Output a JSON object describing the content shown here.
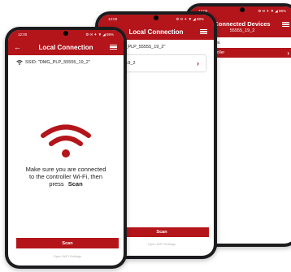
{
  "status_bar": {
    "time": "12:00",
    "indicators": "⚙ ✉ ✦ ▼ ◢ 98%"
  },
  "brand_color": "#b3151b",
  "phone_back": {
    "title": "Connected Devices",
    "subtitle": "55555_19_2",
    "section_label": "Room Devices",
    "device": "agora 4.0 Controller",
    "device_chevron": "›"
  },
  "phone_middle": {
    "title": "Local Connection",
    "ssid_line": "ID: \"DMG_PLP_55555_19_2\"",
    "network": "5555_19_2",
    "network_chevron": "›",
    "scan_label": "Scan",
    "link_label": "Open WiFi Settings"
  },
  "phone_front": {
    "title": "Local Connection",
    "back_icon": "←",
    "ssid_line": "SSID: \"DMG_PLP_55555_19_2\"",
    "message_line1": "Make sure you are connected",
    "message_line2": "to the controller Wi-Fi, then",
    "message_prefix": "press",
    "message_emphasis": "Scan",
    "scan_label": "Scan",
    "link_label": "Open WiFi Settings"
  }
}
